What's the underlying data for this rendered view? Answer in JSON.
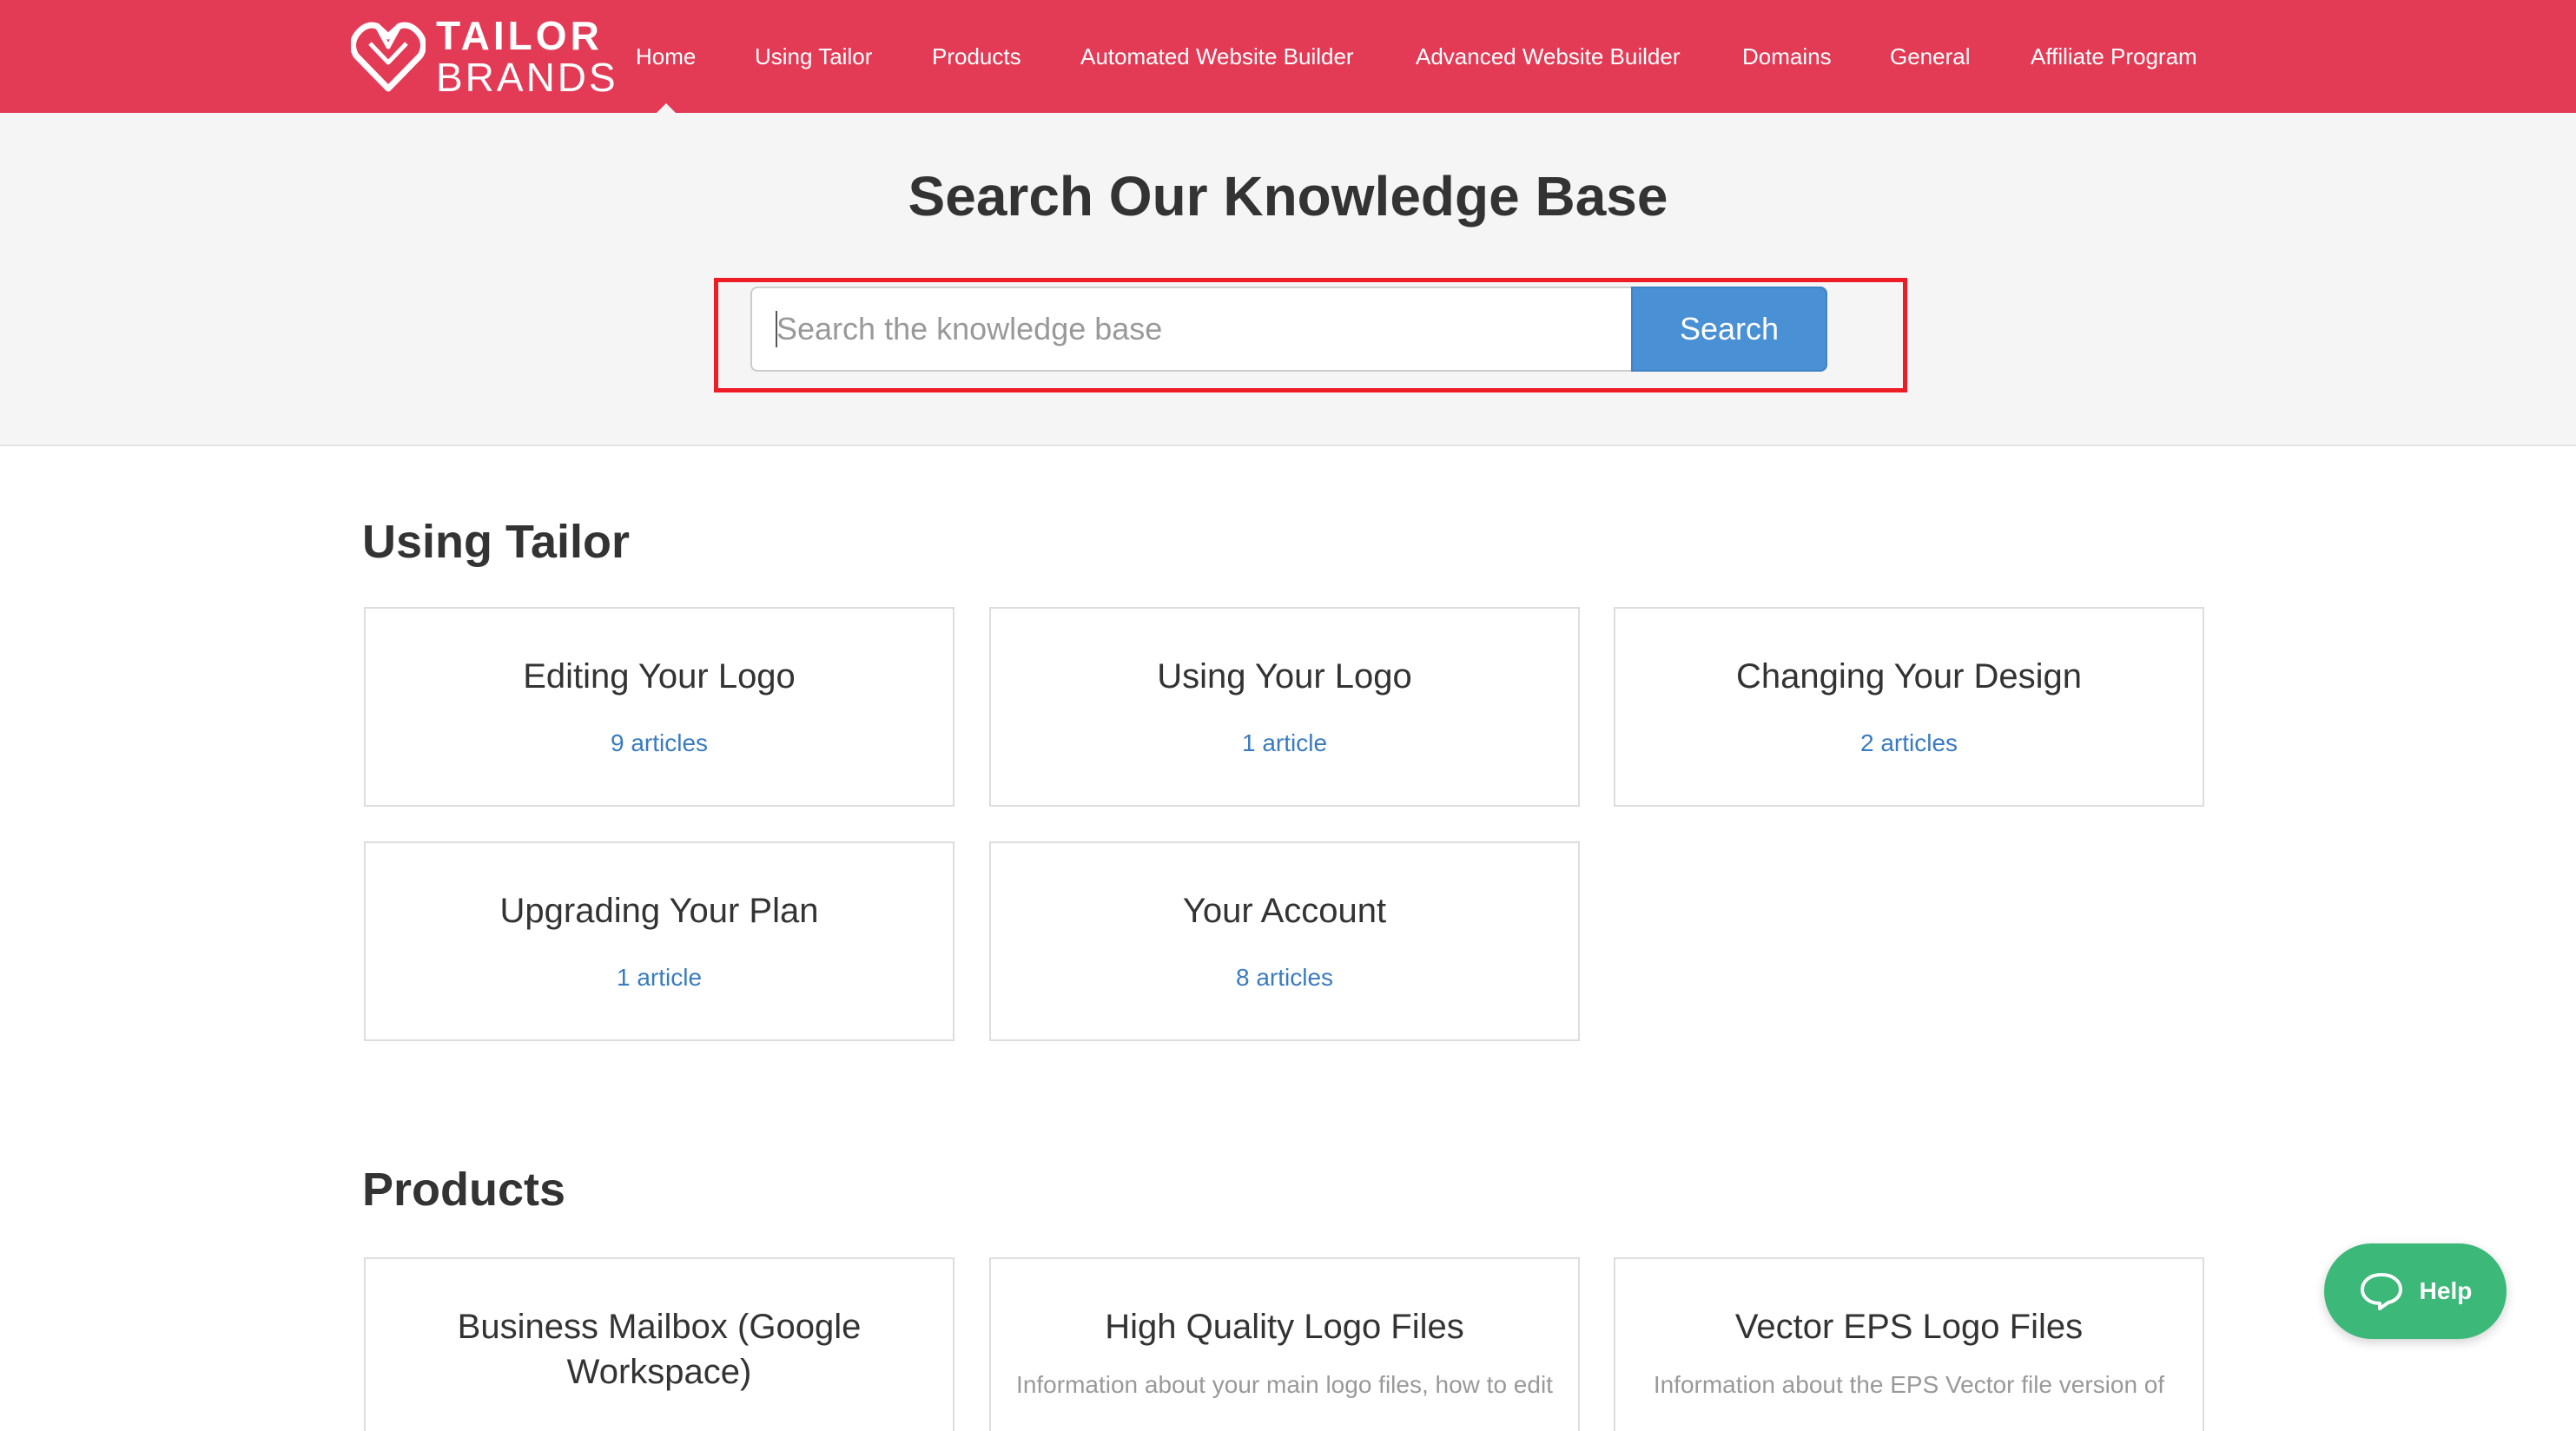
{
  "header": {
    "logo_line1": "TAILOR",
    "logo_line2": "BRANDS",
    "nav": [
      {
        "label": "Home"
      },
      {
        "label": "Using Tailor"
      },
      {
        "label": "Products"
      },
      {
        "label": "Automated Website Builder"
      },
      {
        "label": "Advanced Website Builder"
      },
      {
        "label": "Domains"
      },
      {
        "label": "General"
      },
      {
        "label": "Affiliate Program"
      }
    ],
    "active_nav": "Home"
  },
  "hero": {
    "title": "Search Our Knowledge Base",
    "search_placeholder": "Search the knowledge base",
    "search_value": "",
    "search_button": "Search"
  },
  "sections": [
    {
      "title": "Using Tailor",
      "cards": [
        {
          "title": "Editing Your Logo",
          "count": "9 articles"
        },
        {
          "title": "Using Your Logo",
          "count": "1 article"
        },
        {
          "title": "Changing Your Design",
          "count": "2 articles"
        },
        {
          "title": "Upgrading Your Plan",
          "count": "1 article"
        },
        {
          "title": "Your Account",
          "count": "8 articles"
        }
      ]
    },
    {
      "title": "Products",
      "cards": [
        {
          "title": "Business Mailbox (Google Workspace)"
        },
        {
          "title": "High Quality Logo Files",
          "description": "Information about your main logo files, how to edit"
        },
        {
          "title": "Vector EPS Logo Files",
          "description": "Information about the EPS Vector file version of"
        }
      ]
    }
  ],
  "help_widget": {
    "label": "Help",
    "icon": "chat-bubble-icon"
  },
  "colors": {
    "brand_red": "#e33a56",
    "search_blue": "#4a90d4",
    "link_blue": "#3a7bbf",
    "help_green": "#3cb878",
    "highlight_red": "#ee1c25"
  }
}
